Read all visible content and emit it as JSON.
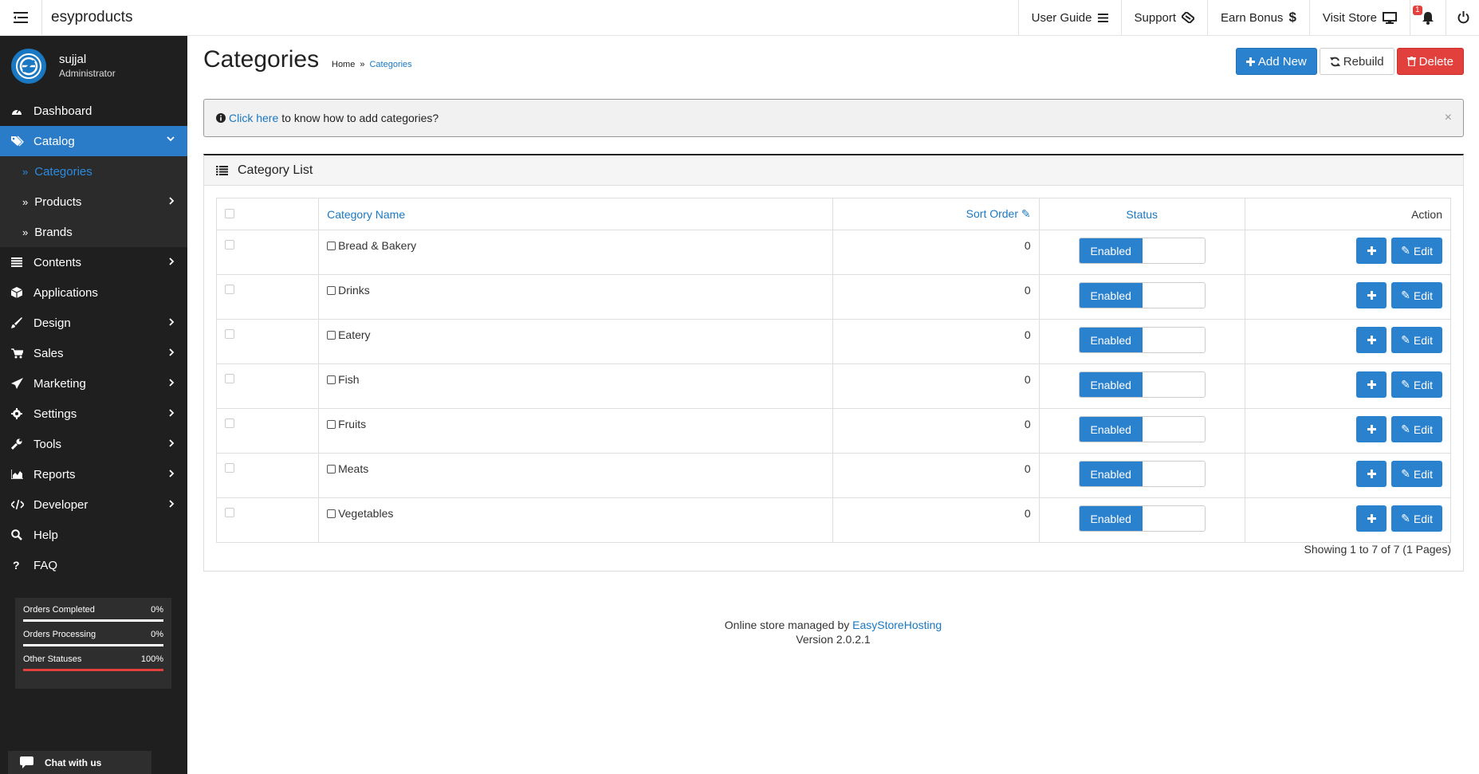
{
  "header": {
    "brand": "esyproducts",
    "nav": {
      "user_guide": "User Guide",
      "support": "Support",
      "earn_bonus": "Earn Bonus",
      "visit_store": "Visit Store",
      "notifications_count": "1"
    }
  },
  "sidebar": {
    "user": {
      "name": "sujjal",
      "role": "Administrator"
    },
    "items": {
      "dashboard": "Dashboard",
      "catalog": "Catalog",
      "categories": "Categories",
      "products": "Products",
      "brands": "Brands",
      "contents": "Contents",
      "applications": "Applications",
      "design": "Design",
      "sales": "Sales",
      "marketing": "Marketing",
      "settings": "Settings",
      "tools": "Tools",
      "reports": "Reports",
      "developer": "Developer",
      "help": "Help",
      "faq": "FAQ"
    },
    "stats": [
      {
        "label": "Orders Completed",
        "value": "0%"
      },
      {
        "label": "Orders Processing",
        "value": "0%"
      },
      {
        "label": "Other Statuses",
        "value": "100%"
      }
    ],
    "chat_label": "Chat with us"
  },
  "page": {
    "title": "Categories",
    "breadcrumb": {
      "home": "Home",
      "current": "Categories"
    },
    "buttons": {
      "add_new": "Add New",
      "rebuild": "Rebuild",
      "delete": "Delete"
    },
    "alert": {
      "link": "Click here",
      "text": "to know how to add categories?",
      "close": "×"
    },
    "panel_title": "Category List",
    "table": {
      "headers": {
        "name": "Category Name",
        "sort": "Sort Order",
        "status": "Status",
        "action": "Action"
      },
      "rows": [
        {
          "name": "Bread & Bakery",
          "sort": "0",
          "status": "Enabled",
          "edit": "Edit"
        },
        {
          "name": "Drinks",
          "sort": "0",
          "status": "Enabled",
          "edit": "Edit"
        },
        {
          "name": "Eatery",
          "sort": "0",
          "status": "Enabled",
          "edit": "Edit"
        },
        {
          "name": "Fish",
          "sort": "0",
          "status": "Enabled",
          "edit": "Edit"
        },
        {
          "name": "Fruits",
          "sort": "0",
          "status": "Enabled",
          "edit": "Edit"
        },
        {
          "name": "Meats",
          "sort": "0",
          "status": "Enabled",
          "edit": "Edit"
        },
        {
          "name": "Vegetables",
          "sort": "0",
          "status": "Enabled",
          "edit": "Edit"
        }
      ],
      "showing": "Showing 1 to 7 of 7 (1 Pages)"
    },
    "footer": {
      "prefix": "Online store managed by",
      "link": "EasyStoreHosting",
      "version": "Version 2.0.2.1"
    }
  },
  "colors": {
    "accent": "#2a82cf",
    "danger": "#e2403d",
    "sidebar": "#1f1f1f"
  }
}
